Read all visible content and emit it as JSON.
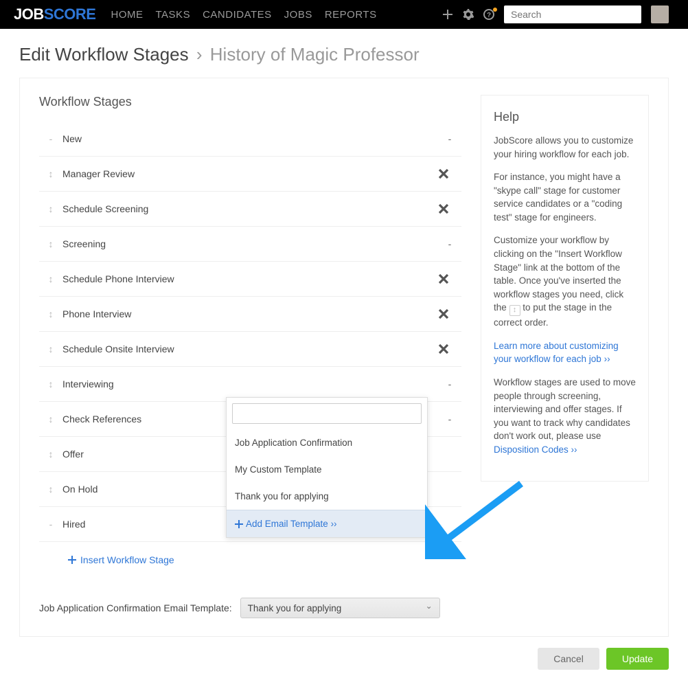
{
  "nav": {
    "logo_a": "JOB",
    "logo_b": "SCORE",
    "links": [
      "HOME",
      "TASKS",
      "CANDIDATES",
      "JOBS",
      "REPORTS"
    ],
    "search_placeholder": "Search"
  },
  "header": {
    "title": "Edit Workflow Stages",
    "subtitle": "History of Magic Professor"
  },
  "section_title": "Workflow Stages",
  "stages": [
    {
      "handle": "-",
      "name": "New",
      "end": "-"
    },
    {
      "handle": "drag",
      "name": "Manager Review",
      "end": "x"
    },
    {
      "handle": "drag",
      "name": "Schedule Screening",
      "end": "x"
    },
    {
      "handle": "drag",
      "name": "Screening",
      "end": "-"
    },
    {
      "handle": "drag",
      "name": "Schedule Phone Interview",
      "end": "x"
    },
    {
      "handle": "drag",
      "name": "Phone Interview",
      "end": "x"
    },
    {
      "handle": "drag",
      "name": "Schedule Onsite Interview",
      "end": "x"
    },
    {
      "handle": "drag",
      "name": "Interviewing",
      "end": "-"
    },
    {
      "handle": "drag",
      "name": "Check References",
      "end": "-"
    },
    {
      "handle": "drag",
      "name": "Offer",
      "end": ""
    },
    {
      "handle": "drag",
      "name": "On Hold",
      "end": ""
    },
    {
      "handle": "-",
      "name": "Hired",
      "end": ""
    }
  ],
  "insert_label": "Insert Workflow Stage",
  "template_field": {
    "label": "Job Application Confirmation Email Template:",
    "value": "Thank you for applying"
  },
  "dropdown": {
    "items": [
      "Job Application Confirmation",
      "My Custom Template",
      "Thank you for applying"
    ],
    "add_label": "Add Email Template ››"
  },
  "help": {
    "title": "Help",
    "p1": "JobScore allows you to customize your hiring workflow for each job.",
    "p2": "For instance, you might have a \"skype call\" stage for customer service candidates or a \"coding test\" stage for engineers.",
    "p3a": "Customize your workflow by clicking on the \"Insert Workflow Stage\" link at the bottom of the table. Once you've inserted the workflow stages you need, click the ",
    "p3b": " to put the stage in the correct order.",
    "link1": "Learn more about customizing your workflow for each job ››",
    "p4": "Workflow stages are used to move people through screening, interviewing and offer stages. If you want to track why candidates don't work out, please use ",
    "link2": "Disposition Codes ››"
  },
  "buttons": {
    "cancel": "Cancel",
    "update": "Update"
  }
}
